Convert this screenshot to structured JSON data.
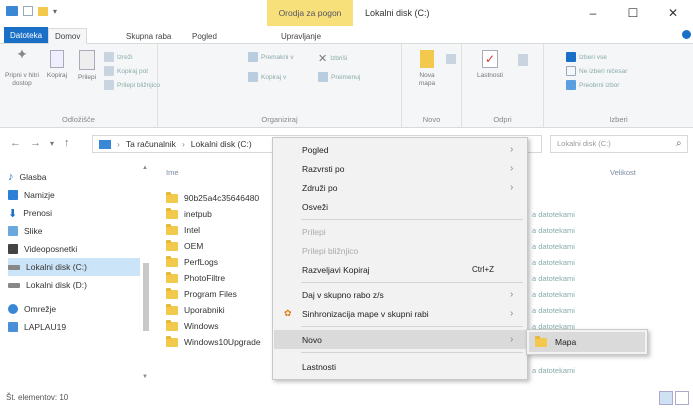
{
  "title_bar": {
    "context_tab": "Orodja za pogon",
    "window_title": "Lokalni disk (C:)",
    "buttons": {
      "minimize": "–",
      "maximize": "☐",
      "close": "✕"
    }
  },
  "ribbon_tabs": [
    "Datoteka",
    "Domov",
    "Skupna raba",
    "Pogled",
    "Upravljanje"
  ],
  "ribbon": {
    "clipboard": {
      "label": "Odložišče",
      "pin": "Pripni v hitri dostop",
      "copy": "Kopiraj",
      "paste": "Prilepi",
      "cut": "Izreži",
      "copy_path": "Kopiraj pot",
      "paste_shortcut": "Prilepi bližnjico"
    },
    "organize": {
      "label": "Organiziraj",
      "move_to": "Premakni v",
      "copy_to": "Kopiraj v",
      "delete": "Izbriši",
      "rename": "Preimenuj"
    },
    "new": {
      "label": "Novo",
      "new_folder": "Nova mapa"
    },
    "open": {
      "label": "Odpri",
      "properties": "Lastnosti"
    },
    "select": {
      "label": "Izberi",
      "select_all": "Izberi vse",
      "select_none": "Ne izberi ničesar",
      "invert": "Preobrni izbor"
    }
  },
  "address": {
    "crumb1": "Ta računalnik",
    "crumb2": "Lokalni disk (C:)",
    "search_placeholder": "Lokalni disk (C:)"
  },
  "nav_items": [
    {
      "label": "Glasba",
      "icon": "music-icon"
    },
    {
      "label": "Namizje",
      "icon": "desktop-icon"
    },
    {
      "label": "Prenosi",
      "icon": "download-icon"
    },
    {
      "label": "Slike",
      "icon": "pictures-icon"
    },
    {
      "label": "Videoposnetki",
      "icon": "video-icon"
    },
    {
      "label": "Lokalni disk (C:)",
      "icon": "drive-icon",
      "selected": true
    },
    {
      "label": "Lokalni disk (D:)",
      "icon": "drive-icon"
    },
    {
      "label": "Omrežje",
      "icon": "network-icon"
    },
    {
      "label": "LAPLAU19",
      "icon": "computer-icon"
    }
  ],
  "columns": {
    "name": "Ime",
    "size": "Velikost"
  },
  "files": [
    {
      "name": "90b25a4c35646480",
      "type": ""
    },
    {
      "name": "inetpub",
      "type": "a datotekami"
    },
    {
      "name": "Intel",
      "type": "a datotekami"
    },
    {
      "name": "OEM",
      "type": "a datotekami"
    },
    {
      "name": "PerfLogs",
      "type": "a datotekami"
    },
    {
      "name": "PhotoFiltre",
      "type": "a datotekami"
    },
    {
      "name": "Program Files",
      "type": "a datotekami"
    },
    {
      "name": "Uporabniki",
      "type": "a datotekami"
    },
    {
      "name": "Windows",
      "type": "a datotekami"
    },
    {
      "name": "Windows10Upgrade",
      "type": "a datotekami"
    }
  ],
  "context_menu": {
    "view": "Pogled",
    "sort_by": "Razvrsti po",
    "group_by": "Združi po",
    "refresh": "Osveži",
    "paste": "Prilepi",
    "paste_shortcut": "Prilepi bližnjico",
    "undo_copy": "Razveljavi Kopiraj",
    "undo_shortcut": "Ctrl+Z",
    "share_with": "Daj v skupno rabo z/s",
    "sync_shared": "Sinhronizacija mape v skupni rabi",
    "new": "Novo",
    "properties": "Lastnosti"
  },
  "submenu": {
    "folder": "Mapa"
  },
  "status": {
    "items": "Št. elementov: 10"
  },
  "colors": {
    "accent": "#1a6fc6",
    "context_tab": "#f7e07a",
    "folder": "#f2c94c",
    "selection": "#cce4f7"
  }
}
